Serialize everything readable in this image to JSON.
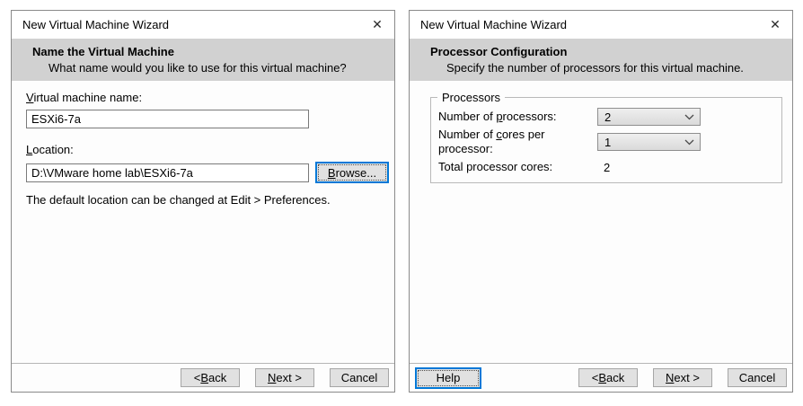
{
  "colors": {
    "header_band": "#d1d1d1",
    "dialog_bg": "#fdfdfd",
    "dialog_border": "#8a8a8a",
    "button_bg": "#e1e1e1",
    "focus_accent": "#0078d7"
  },
  "left_dialog": {
    "title": "New Virtual Machine Wizard",
    "close_icon": "✕",
    "header_title": "Name the Virtual Machine",
    "header_subtitle": "What name would you like to use for this virtual machine?",
    "vm_name_label": {
      "pre": "",
      "key": "V",
      "post": "irtual machine name:"
    },
    "vm_name_value": "ESXi6-7a",
    "location_label": {
      "pre": "",
      "key": "L",
      "post": "ocation:"
    },
    "location_value": "D:\\VMware home lab\\ESXi6-7a",
    "browse_button": {
      "pre": "",
      "key": "B",
      "post": "rowse..."
    },
    "hint": "The default location can be changed at Edit > Preferences.",
    "back_button": {
      "pre": "< ",
      "key": "B",
      "post": "ack"
    },
    "next_button": {
      "pre": "",
      "key": "N",
      "post": "ext >"
    },
    "cancel_button": "Cancel"
  },
  "right_dialog": {
    "title": "New Virtual Machine Wizard",
    "close_icon": "✕",
    "header_title": "Processor Configuration",
    "header_subtitle": "Specify the number of processors for this virtual machine.",
    "group_legend": "Processors",
    "processors_label": {
      "pre": "Number of ",
      "key": "p",
      "post": "rocessors:"
    },
    "processors_value": "2",
    "cores_label": {
      "pre": "Number of ",
      "key": "c",
      "post": "ores per processor:"
    },
    "cores_value": "1",
    "total_label": "Total processor cores:",
    "total_value": "2",
    "help_button": "Help",
    "back_button": {
      "pre": "< ",
      "key": "B",
      "post": "ack"
    },
    "next_button": {
      "pre": "",
      "key": "N",
      "post": "ext >"
    },
    "cancel_button": "Cancel"
  }
}
